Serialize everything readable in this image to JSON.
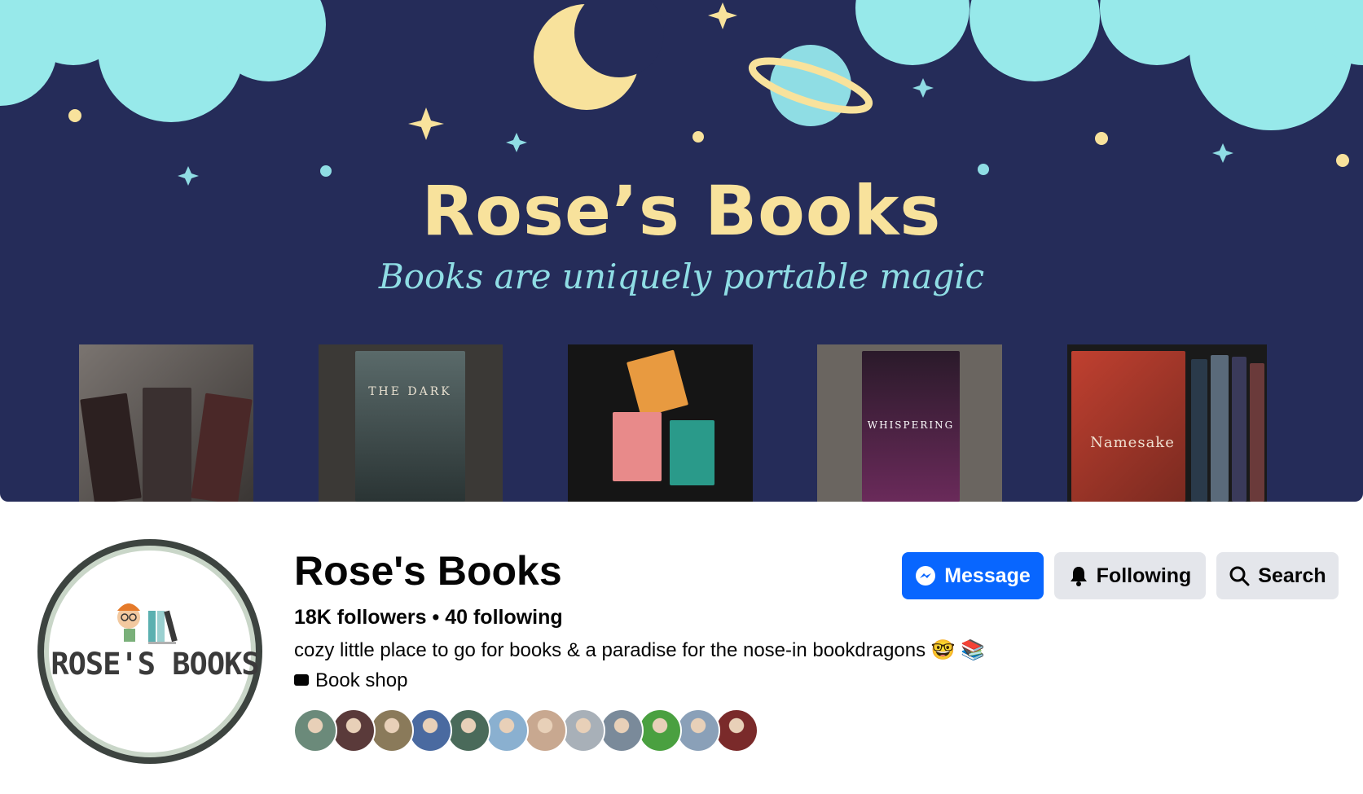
{
  "cover": {
    "title": "Rose’s Books",
    "tagline": "Books are uniquely portable magic",
    "book_photo_captions": [
      "",
      "THE DARK",
      "",
      "WHISPERING",
      "Namesake"
    ],
    "colors": {
      "background": "#252c59",
      "title": "#f8e29c",
      "tagline": "#8fdde4",
      "cloud": "#97e9ea"
    }
  },
  "avatar": {
    "logo_text": "ROSE'S BOOKS"
  },
  "profile": {
    "name": "Rose's Books",
    "followers": "18K followers",
    "separator": " • ",
    "following": "40 following",
    "bio": "cozy little place to go for books & a paradise for the nose-in bookdragons 🤓 📚",
    "category": "Book shop"
  },
  "actions": {
    "message_label": "Message",
    "following_label": "Following",
    "search_label": "Search"
  },
  "friends": {
    "avatars": [
      {
        "icon": "friend-avatar",
        "color": "#6b8a7a"
      },
      {
        "icon": "friend-avatar",
        "color": "#5a3a3a"
      },
      {
        "icon": "friend-avatar",
        "color": "#8a7a5a"
      },
      {
        "icon": "friend-avatar",
        "color": "#4a6aa0"
      },
      {
        "icon": "friend-avatar",
        "color": "#4a6a5a"
      },
      {
        "icon": "friend-avatar",
        "color": "#8ab0d0"
      },
      {
        "icon": "friend-avatar",
        "color": "#c8a890"
      },
      {
        "icon": "friend-avatar",
        "color": "#a8b0b8"
      },
      {
        "icon": "friend-avatar",
        "color": "#7a8a9a"
      },
      {
        "icon": "friend-avatar",
        "color": "#4aa040"
      },
      {
        "icon": "friend-avatar",
        "color": "#8aa0b8"
      },
      {
        "icon": "friend-avatar",
        "color": "#7a2a2a"
      }
    ]
  }
}
